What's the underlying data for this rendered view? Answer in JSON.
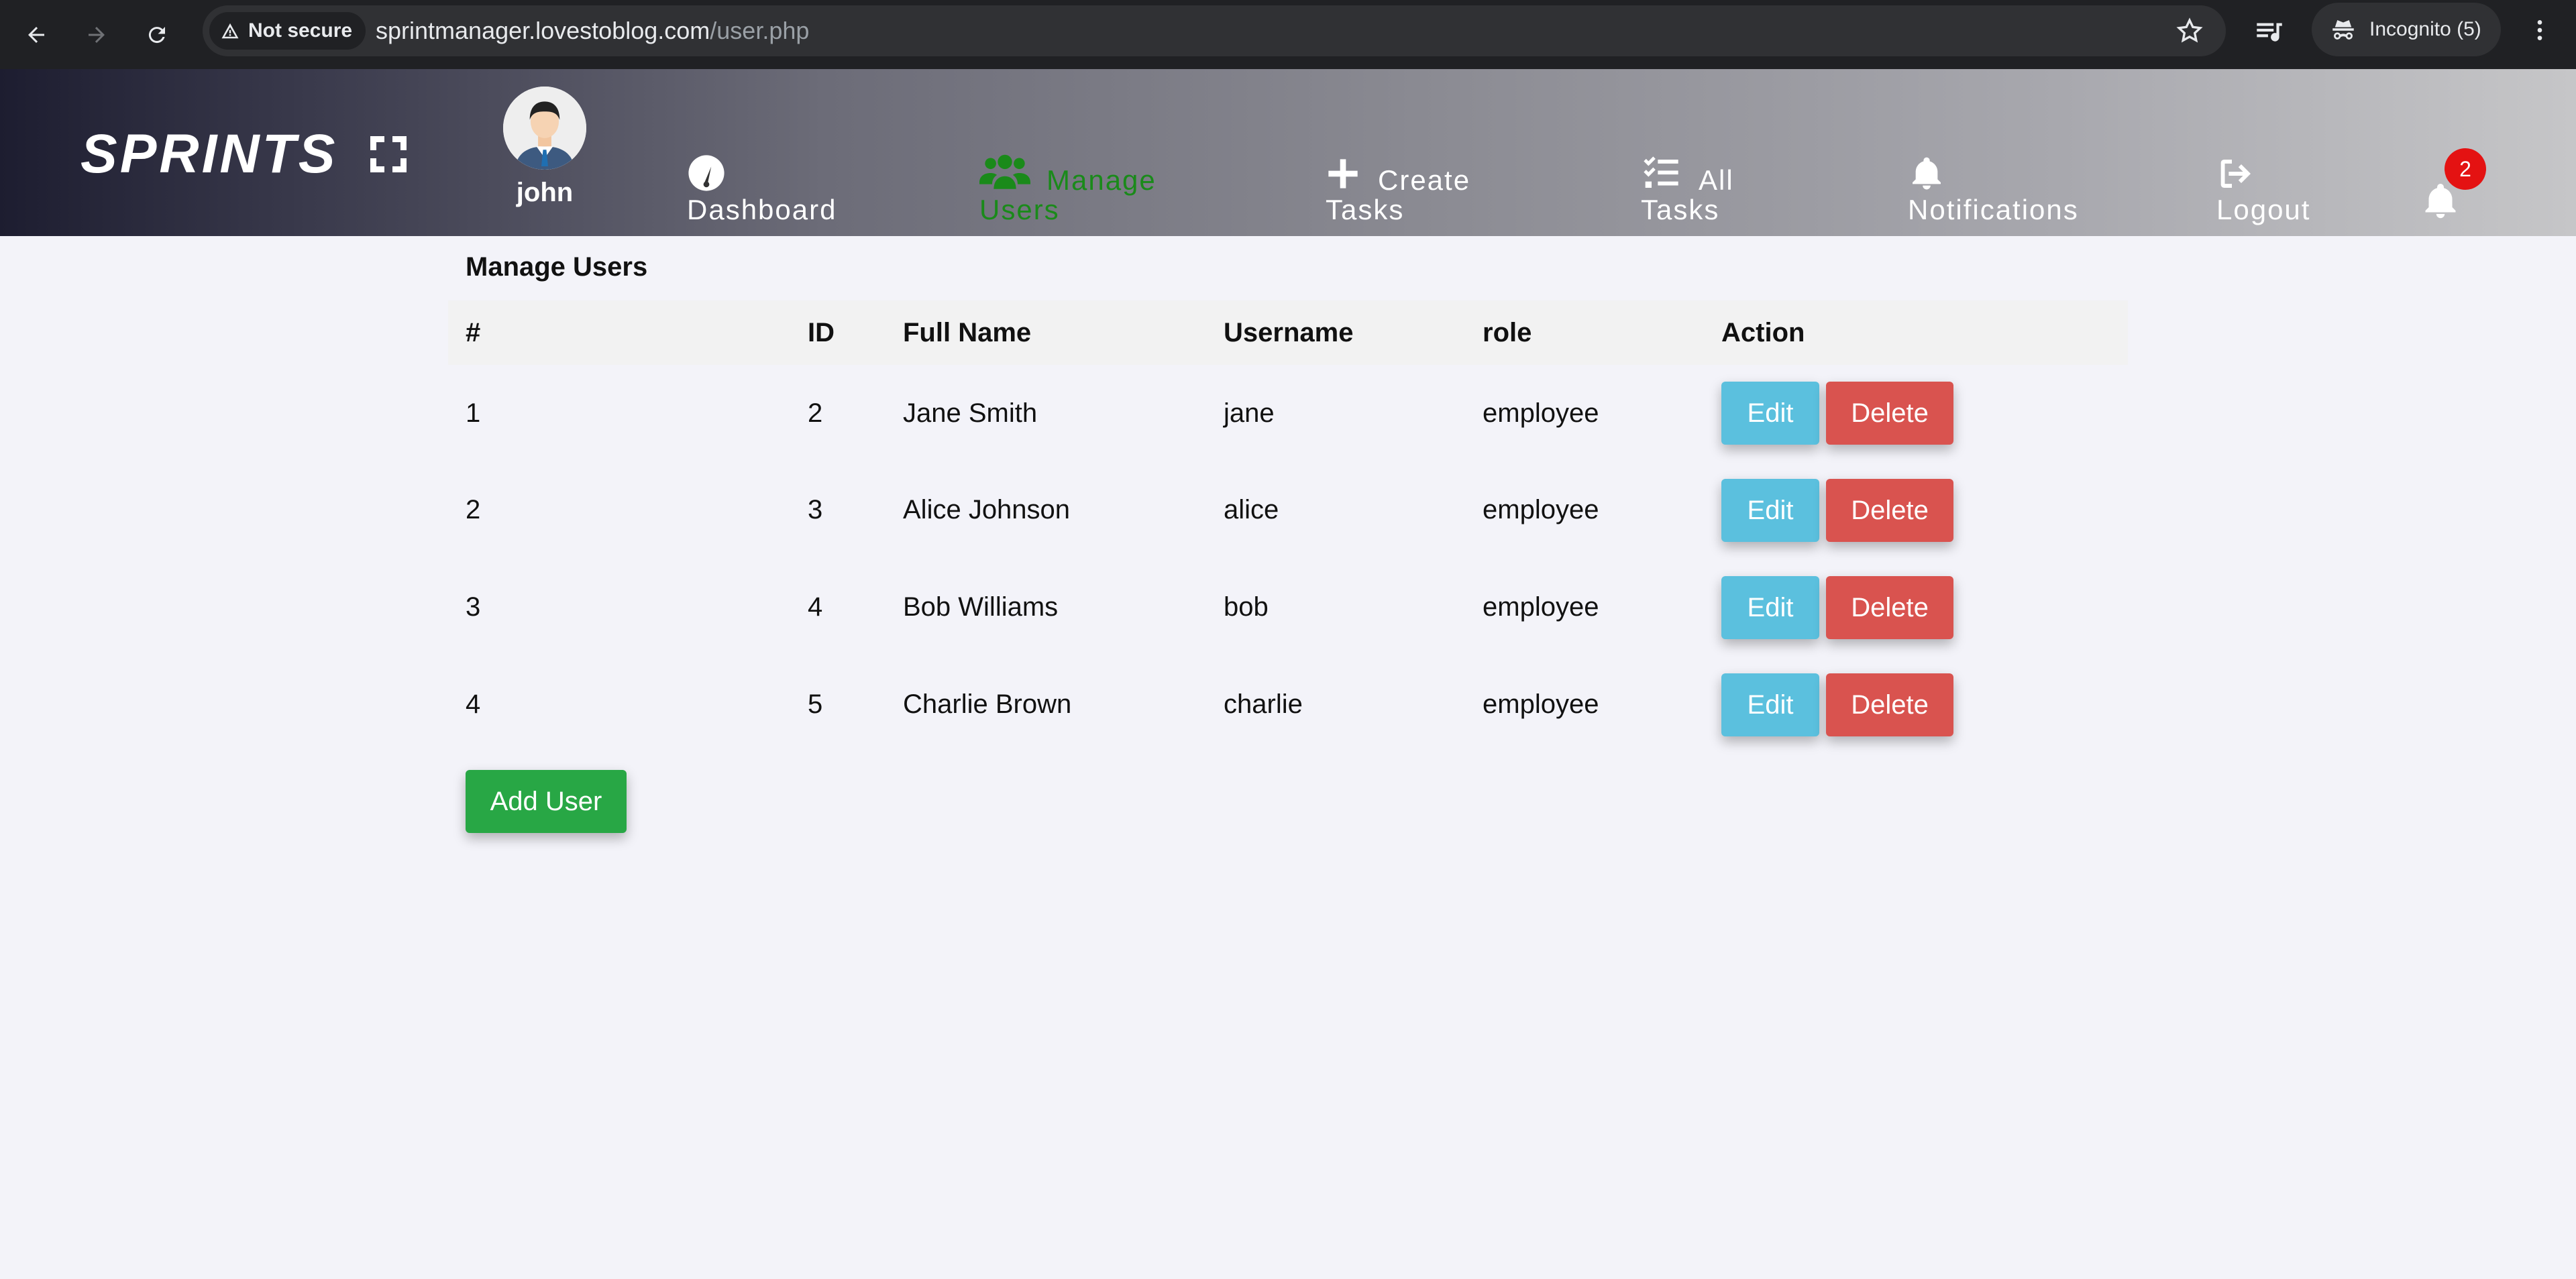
{
  "browser": {
    "security_label": "Not secure",
    "url_host": "sprintmanager.lovestoblog.com",
    "url_path": "/user.php",
    "incognito_label": "Incognito (5)"
  },
  "header": {
    "brand": "SPRINTS",
    "user_name": "john",
    "nav": {
      "dashboard": [
        "Dashboard"
      ],
      "manage_users": [
        "Manage",
        "Users"
      ],
      "create_tasks": [
        "Create",
        "Tasks"
      ],
      "all_tasks": [
        "All",
        "Tasks"
      ],
      "notifications": [
        "Notifications"
      ],
      "logout": [
        "Logout"
      ]
    },
    "active_color": "#1a8a1a",
    "notification_count": "2"
  },
  "main": {
    "title": "Manage Users",
    "columns": [
      "#",
      "ID",
      "Full Name",
      "Username",
      "role",
      "Action"
    ],
    "rows": [
      {
        "num": "1",
        "id": "2",
        "full_name": "Jane Smith",
        "username": "jane",
        "role": "employee"
      },
      {
        "num": "2",
        "id": "3",
        "full_name": "Alice Johnson",
        "username": "alice",
        "role": "employee"
      },
      {
        "num": "3",
        "id": "4",
        "full_name": "Bob Williams",
        "username": "bob",
        "role": "employee"
      },
      {
        "num": "4",
        "id": "5",
        "full_name": "Charlie Brown",
        "username": "charlie",
        "role": "employee"
      }
    ],
    "edit_label": "Edit",
    "delete_label": "Delete",
    "add_user_label": "Add User"
  }
}
